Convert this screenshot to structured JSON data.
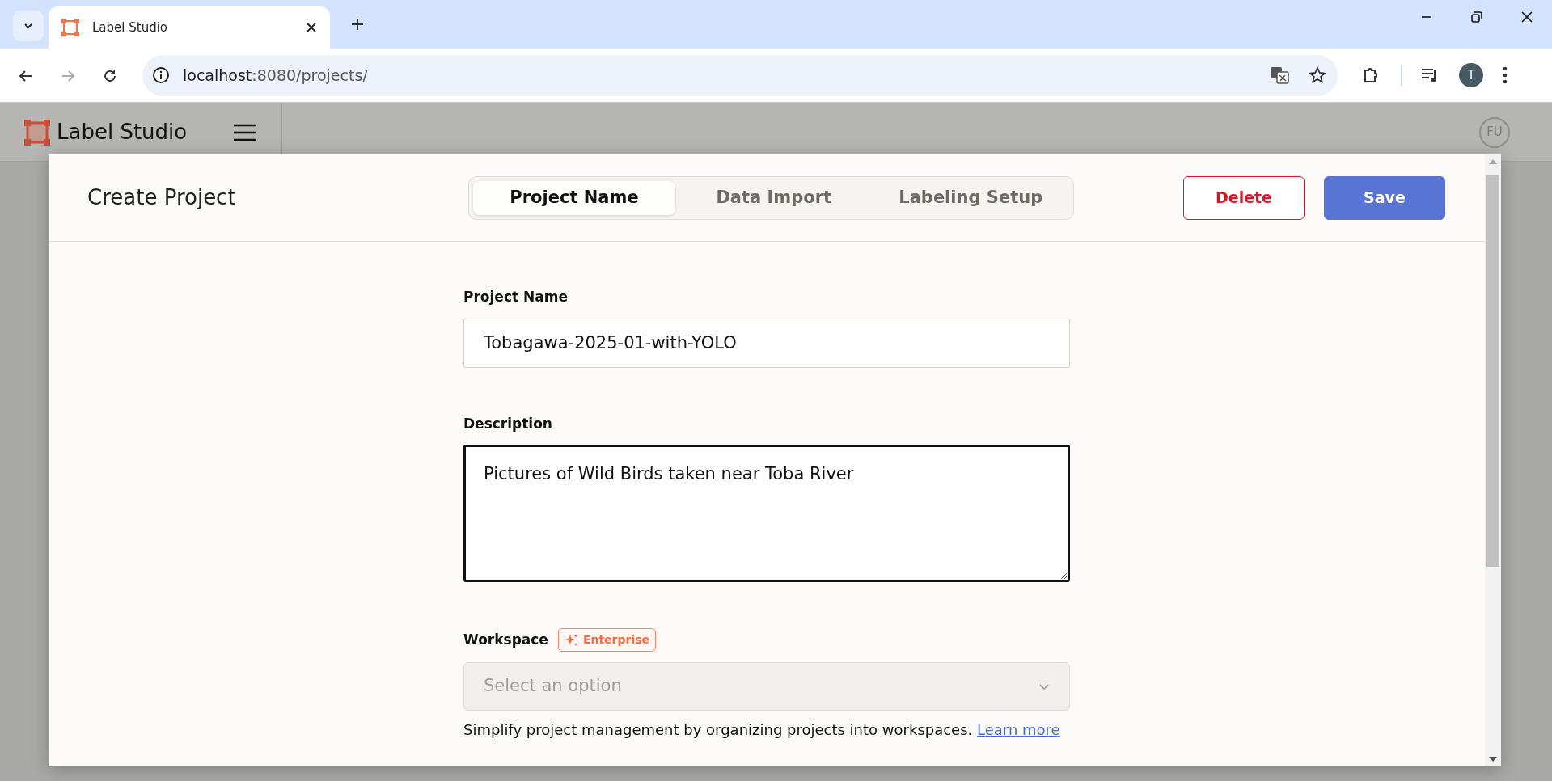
{
  "browser": {
    "tab_title": "Label Studio",
    "url_host": "localhost",
    "url_rest": ":8080/projects/",
    "profile_initial": "T"
  },
  "app": {
    "brand": "Label Studio",
    "user_initials": "FU"
  },
  "modal": {
    "title": "Create Project",
    "steps": [
      {
        "label": "Project Name",
        "selected": true
      },
      {
        "label": "Data Import",
        "selected": false
      },
      {
        "label": "Labeling Setup",
        "selected": false
      }
    ],
    "buttons": [
      {
        "label": "Delete",
        "kind": "danger"
      },
      {
        "label": "Save",
        "kind": "primary"
      }
    ],
    "fields": [
      {
        "kind": "input",
        "label": "Project Name",
        "value": "Tobagawa-2025-01-with-YOLO"
      },
      {
        "kind": "textarea",
        "label": "Description",
        "value": "Pictures of Wild Birds taken near Toba River",
        "focused": true
      },
      {
        "kind": "select",
        "label": "Workspace",
        "badge": "Enterprise",
        "placeholder": "Select an option",
        "disabled": true,
        "help": "Simplify project management by organizing projects into workspaces.",
        "link": "Learn more"
      }
    ]
  }
}
